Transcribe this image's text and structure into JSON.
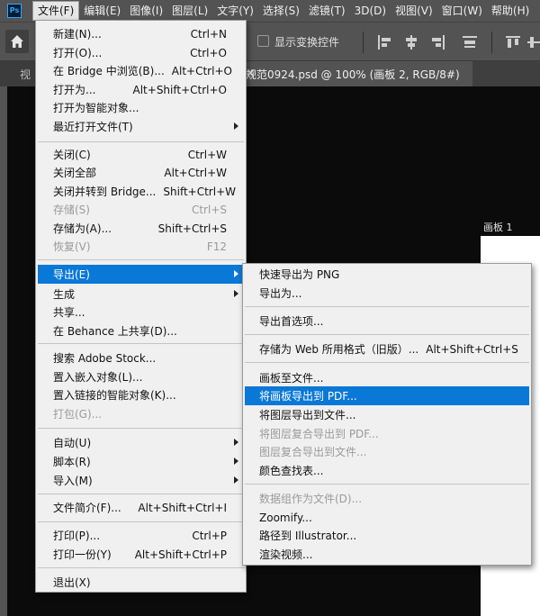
{
  "app": {
    "logo": "Ps"
  },
  "menubar": {
    "items": [
      "文件(F)",
      "编辑(E)",
      "图像(I)",
      "图层(L)",
      "文字(Y)",
      "选择(S)",
      "滤镜(T)",
      "3D(D)",
      "视图(V)",
      "窗口(W)",
      "帮助(H)"
    ]
  },
  "options": {
    "show_transform_label": "显示变换控件"
  },
  "tab": {
    "left_text": "视",
    "active_title": "规范0924.psd @ 100% (画板 2, RGB/8#)",
    "close_glyph": "×"
  },
  "canvas": {
    "artboard_label": "画板 1"
  },
  "file_menu": {
    "items": [
      {
        "label": "新建(N)...",
        "shortcut": "Ctrl+N"
      },
      {
        "label": "打开(O)...",
        "shortcut": "Ctrl+O"
      },
      {
        "label": "在 Bridge 中浏览(B)...",
        "shortcut": "Alt+Ctrl+O"
      },
      {
        "label": "打开为...",
        "shortcut": "Alt+Shift+Ctrl+O"
      },
      {
        "label": "打开为智能对象...",
        "shortcut": ""
      },
      {
        "label": "最近打开文件(T)",
        "shortcut": ""
      },
      {
        "label": "关闭(C)",
        "shortcut": "Ctrl+W"
      },
      {
        "label": "关闭全部",
        "shortcut": "Alt+Ctrl+W"
      },
      {
        "label": "关闭并转到 Bridge...",
        "shortcut": "Shift+Ctrl+W"
      },
      {
        "label": "存储(S)",
        "shortcut": "Ctrl+S"
      },
      {
        "label": "存储为(A)...",
        "shortcut": "Shift+Ctrl+S"
      },
      {
        "label": "恢复(V)",
        "shortcut": "F12"
      },
      {
        "label": "导出(E)",
        "shortcut": ""
      },
      {
        "label": "生成",
        "shortcut": ""
      },
      {
        "label": "共享...",
        "shortcut": ""
      },
      {
        "label": "在 Behance 上共享(D)...",
        "shortcut": ""
      },
      {
        "label": "搜索 Adobe Stock...",
        "shortcut": ""
      },
      {
        "label": "置入嵌入对象(L)...",
        "shortcut": ""
      },
      {
        "label": "置入链接的智能对象(K)...",
        "shortcut": ""
      },
      {
        "label": "打包(G)...",
        "shortcut": ""
      },
      {
        "label": "自动(U)",
        "shortcut": ""
      },
      {
        "label": "脚本(R)",
        "shortcut": ""
      },
      {
        "label": "导入(M)",
        "shortcut": ""
      },
      {
        "label": "文件简介(F)...",
        "shortcut": "Alt+Shift+Ctrl+I"
      },
      {
        "label": "打印(P)...",
        "shortcut": "Ctrl+P"
      },
      {
        "label": "打印一份(Y)",
        "shortcut": "Alt+Shift+Ctrl+P"
      },
      {
        "label": "退出(X)",
        "shortcut": ""
      }
    ]
  },
  "export_menu": {
    "items": [
      {
        "label": "快速导出为 PNG",
        "shortcut": ""
      },
      {
        "label": "导出为...",
        "shortcut": ""
      },
      {
        "label": "导出首选项...",
        "shortcut": ""
      },
      {
        "label": "存储为 Web 所用格式（旧版）...",
        "shortcut": "Alt+Shift+Ctrl+S"
      },
      {
        "label": "画板至文件...",
        "shortcut": ""
      },
      {
        "label": "将画板导出到 PDF...",
        "shortcut": ""
      },
      {
        "label": "将图层导出到文件...",
        "shortcut": ""
      },
      {
        "label": "将图层复合导出到 PDF...",
        "shortcut": ""
      },
      {
        "label": "图层复合导出到文件...",
        "shortcut": ""
      },
      {
        "label": "颜色查找表...",
        "shortcut": ""
      },
      {
        "label": "数据组作为文件(D)...",
        "shortcut": ""
      },
      {
        "label": "Zoomify...",
        "shortcut": ""
      },
      {
        "label": "路径到 Illustrator...",
        "shortcut": ""
      },
      {
        "label": "渲染视频...",
        "shortcut": ""
      }
    ]
  }
}
